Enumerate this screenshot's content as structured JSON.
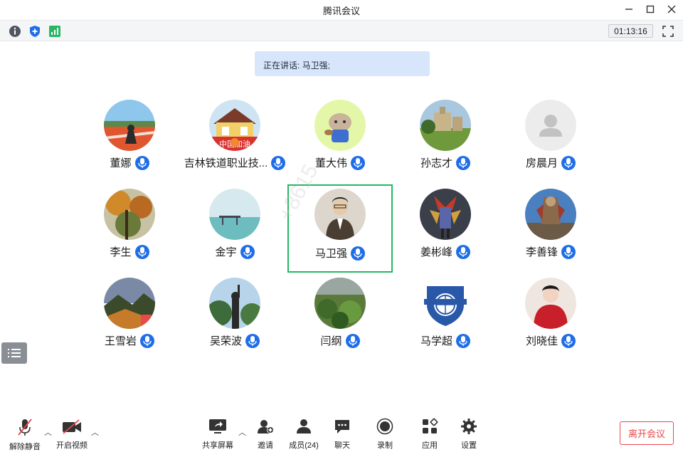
{
  "window": {
    "title": "腾讯会议"
  },
  "toolbar": {
    "timer": "01:13:16"
  },
  "speaking": {
    "label": "正在讲话: 马卫强;"
  },
  "participants": [
    {
      "name": "董娜"
    },
    {
      "name": "吉林铁道职业技..."
    },
    {
      "name": "董大伟"
    },
    {
      "name": "孙志才"
    },
    {
      "name": "房晨月"
    },
    {
      "name": "李生"
    },
    {
      "name": "金宇"
    },
    {
      "name": "马卫强"
    },
    {
      "name": "姜彬峰"
    },
    {
      "name": "李善锋"
    },
    {
      "name": "王雪岩"
    },
    {
      "name": "吴荣波"
    },
    {
      "name": "闫纲"
    },
    {
      "name": "马学超"
    },
    {
      "name": "刘晓佳"
    }
  ],
  "avatar_texts": {
    "poster": "中国加油"
  },
  "watermark": "+8615",
  "bottombar": {
    "unmute": "解除静音",
    "start_video": "开启视频",
    "share_screen": "共享屏幕",
    "invite": "邀请",
    "members": "成员(24)",
    "chat": "聊天",
    "record": "录制",
    "apps": "应用",
    "settings": "设置",
    "leave": "离开会议"
  },
  "colors": {
    "accent": "#1f6ee8",
    "active_border": "#27b662",
    "leave": "#e8474c",
    "speaking_bg": "#d7e6fb"
  }
}
